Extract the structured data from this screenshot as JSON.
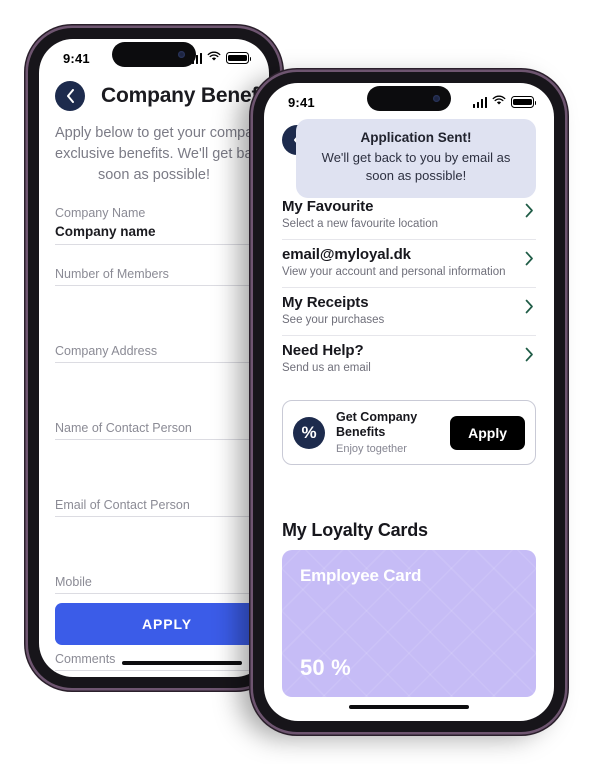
{
  "back_phone": {
    "status": {
      "time": "9:41",
      "signal_icon": "cellular-bars-icon",
      "wifi_icon": "wifi-icon",
      "battery_icon": "battery-full-icon"
    },
    "back_icon": "chevron-left-icon",
    "title": "Company Benefits",
    "subtitle": "Apply below to get your company exclusive benefits. We'll get back to you as soon as possible!",
    "fields": [
      {
        "label": "Company Name",
        "value": "Company name"
      },
      {
        "label": "Number of Members",
        "value": ""
      },
      {
        "label": "Company Address",
        "value": ""
      },
      {
        "label": "Name of Contact Person",
        "value": ""
      },
      {
        "label": "Email of Contact Person",
        "value": ""
      },
      {
        "label": "Mobile",
        "value": ""
      },
      {
        "label": "Comments",
        "value": ""
      }
    ],
    "apply_label": "APPLY",
    "accent_blue": "#3b5ce8",
    "navy": "#1d2b4d"
  },
  "front_phone": {
    "status": {
      "time": "9:41",
      "signal_icon": "cellular-bars-icon",
      "wifi_icon": "wifi-icon",
      "battery_icon": "battery-full-icon"
    },
    "back_icon": "chevron-left-icon",
    "toast": {
      "title": "Application Sent!",
      "message": "We'll get back to you by email as soon as possible!",
      "bg": "#dfe2f1"
    },
    "list": [
      {
        "title": "My Favourite",
        "subtitle": "Select a new favourite location",
        "chevron": "chevron-right-icon"
      },
      {
        "title": "email@myloyal.dk",
        "subtitle": "View your account and personal information",
        "chevron": "chevron-right-icon"
      },
      {
        "title": "My Receipts",
        "subtitle": "See your purchases",
        "chevron": "chevron-right-icon"
      },
      {
        "title": "Need Help?",
        "subtitle": "Send us an email",
        "chevron": "chevron-right-icon"
      }
    ],
    "promo": {
      "icon": "percent-icon",
      "icon_glyph": "%",
      "title": "Get Company Benefits",
      "subtitle": "Enjoy together",
      "button_label": "Apply"
    },
    "cards_heading": "My Loyalty Cards",
    "loyalty_card": {
      "name": "Employee Card",
      "discount": "50 %",
      "color": "#c6bcf6"
    },
    "chevron_color": "#1f5c46"
  }
}
